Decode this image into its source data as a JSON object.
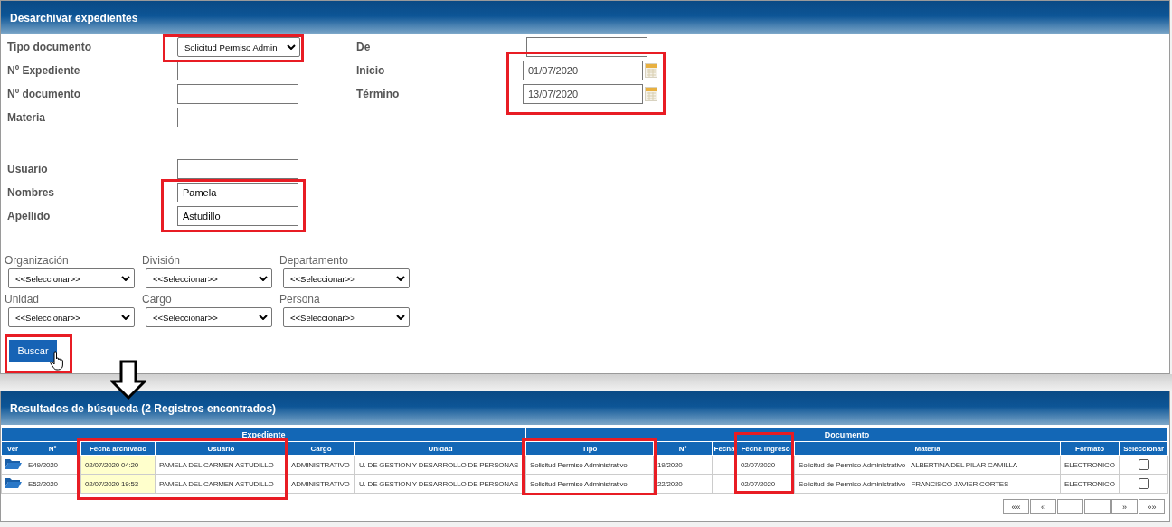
{
  "panel_title": "Desarchivar expedientes",
  "fields_left": [
    {
      "label": "Tipo documento",
      "kind": "select",
      "value": "Solicitud Permiso Admin"
    },
    {
      "label": "Nº Expediente",
      "kind": "text"
    },
    {
      "label": "Nº documento",
      "kind": "text"
    },
    {
      "label": "Materia",
      "kind": "text"
    }
  ],
  "user_fields": [
    {
      "label": "Usuario",
      "kind": "text"
    },
    {
      "label": "Nombres",
      "kind": "text",
      "value": "Pamela"
    },
    {
      "label": "Apellido",
      "kind": "text",
      "value": "Astudillo"
    }
  ],
  "fields_right": [
    {
      "label": "De",
      "kind": "text"
    },
    {
      "label": "Inicio",
      "kind": "date",
      "value": "01/07/2020"
    },
    {
      "label": "Término",
      "kind": "date",
      "value": "13/07/2020"
    }
  ],
  "filters": [
    {
      "label": "Organización",
      "value": "<<Seleccionar>>"
    },
    {
      "label": "División",
      "value": "<<Seleccionar>>"
    },
    {
      "label": "Departamento",
      "value": "<<Seleccionar>>"
    },
    {
      "label": "Unidad",
      "value": "<<Seleccionar>>"
    },
    {
      "label": "Cargo",
      "value": "<<Seleccionar>>"
    },
    {
      "label": "Persona",
      "value": "<<Seleccionar>>"
    }
  ],
  "search_button": "Buscar",
  "results": {
    "title": "Resultados de búsqueda (2 Registros encontrados)",
    "column_groups": [
      {
        "label": "Expediente",
        "columns": [
          {
            "label": "Ver",
            "kind": "icon"
          },
          {
            "label": "Nº",
            "kind": "text"
          },
          {
            "label": "Fecha archivado",
            "kind": "highlight"
          },
          {
            "label": "Usuario",
            "kind": "text"
          },
          {
            "label": "Cargo",
            "kind": "text"
          },
          {
            "label": "Unidad",
            "kind": "text"
          }
        ]
      },
      {
        "label": "Documento",
        "columns": [
          {
            "label": "Tipo",
            "kind": "text"
          },
          {
            "label": "Nº",
            "kind": "text"
          },
          {
            "label": "Fecha",
            "kind": "text"
          },
          {
            "label": "Fecha ingreso",
            "kind": "text"
          },
          {
            "label": "Materia",
            "kind": "text"
          },
          {
            "label": "Formato",
            "kind": "text"
          },
          {
            "label": "Seleccionar",
            "kind": "checkbox"
          }
        ]
      }
    ],
    "rows": [
      {
        "cells": [
          "E49/2020",
          "02/07/2020 04:20",
          "PAMELA DEL CARMEN ASTUDILLO",
          "ADMINISTRATIVO",
          "U. DE GESTION Y DESARROLLO DE PERSONAS",
          "Solicitud Permiso Administrativo",
          "19/2020",
          null,
          "02/07/2020",
          "Solicitud de Permiso Administrativo - ALBERTINA DEL PILAR CAMILLA",
          "ELECTRONICO"
        ],
        "checked": false
      },
      {
        "cells": [
          "E52/2020",
          "02/07/2020 19:53",
          "PAMELA DEL CARMEN ASTUDILLO",
          "ADMINISTRATIVO",
          "U. DE GESTION Y DESARROLLO DE PERSONAS",
          "Solicitud Permiso Administrativo",
          "22/2020",
          null,
          "02/07/2020",
          "Solicitud de Permiso Administrativo - FRANCISCO JAVIER CORTES",
          "ELECTRONICO"
        ],
        "checked": false
      }
    ],
    "pagination": {
      "first": "««",
      "prev": "«",
      "next": "»",
      "last": "»»"
    }
  }
}
